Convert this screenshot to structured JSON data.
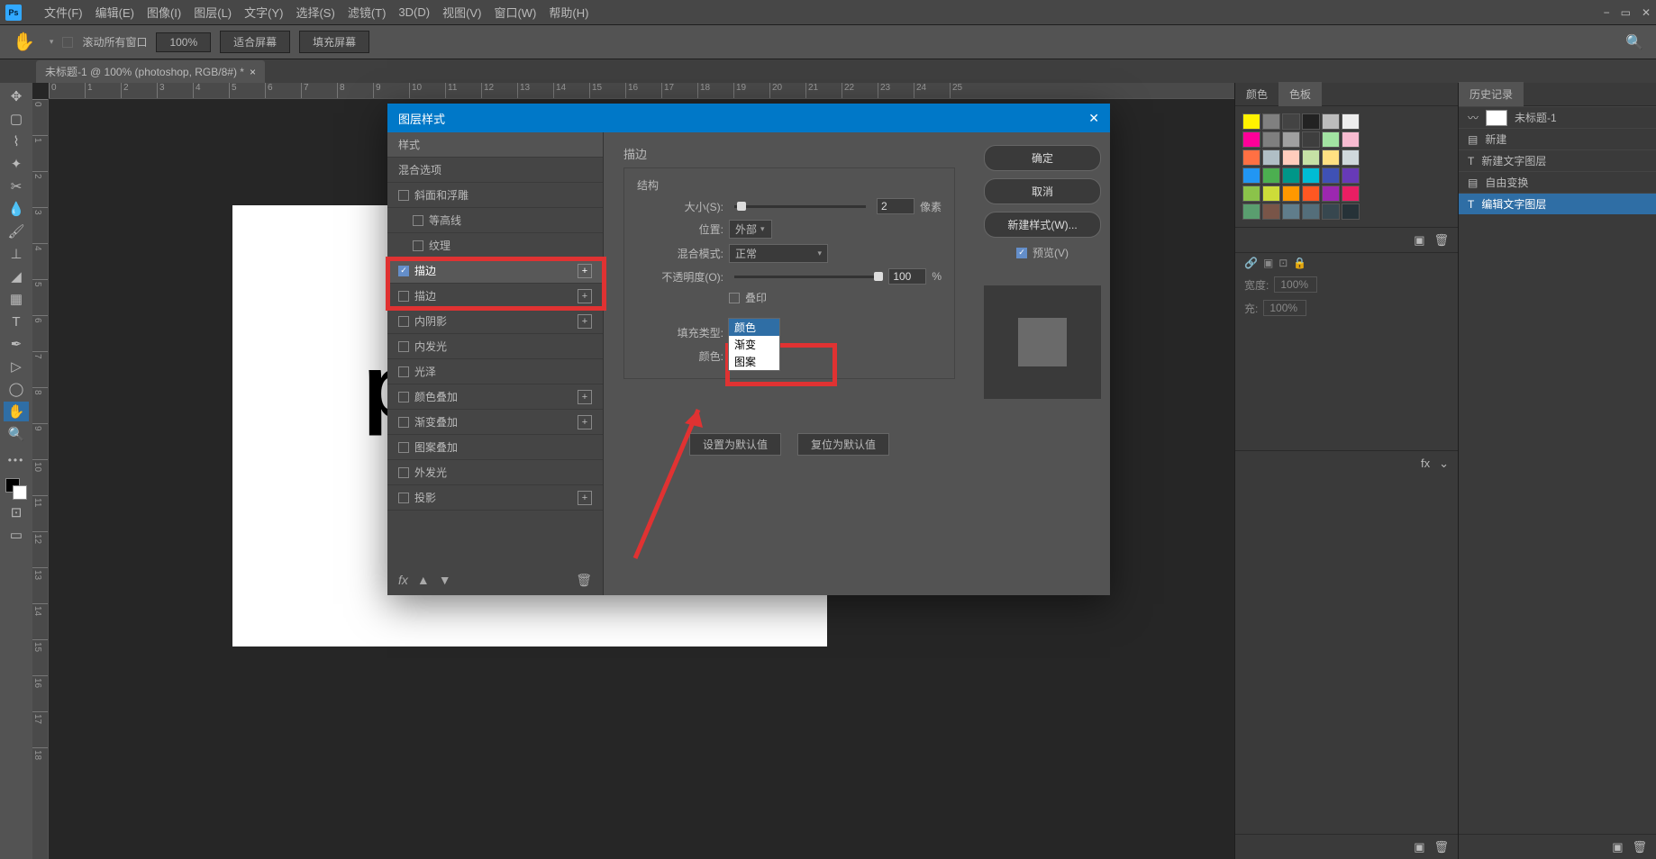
{
  "menubar": {
    "items": [
      "文件(F)",
      "编辑(E)",
      "图像(I)",
      "图层(L)",
      "文字(Y)",
      "选择(S)",
      "滤镜(T)",
      "3D(D)",
      "视图(V)",
      "窗口(W)",
      "帮助(H)"
    ]
  },
  "options": {
    "scroll_all": "滚动所有窗口",
    "zoom_label": "100%",
    "fit_screen": "适合屏幕",
    "fill_screen": "填充屏幕"
  },
  "doc_tab": {
    "title": "未标题-1 @ 100% (photoshop, RGB/8#) *"
  },
  "color_panel": {
    "tab1": "颜色",
    "tab2": "色板"
  },
  "history_panel": {
    "tab": "历史记录",
    "doc": "未标题-1",
    "items": [
      "新建",
      "新建文字图层",
      "自由变换",
      "编辑文字图层"
    ]
  },
  "props": {
    "width_label": "宽度:",
    "width": "100%",
    "fill_label": "充:",
    "fill": "100%"
  },
  "canvas_text": "pl",
  "dialog": {
    "title": "图层样式",
    "styles_header": "样式",
    "blend_header": "混合选项",
    "items": [
      {
        "label": "斜面和浮雕",
        "checked": false
      },
      {
        "label": "等高线",
        "checked": false,
        "indent": true
      },
      {
        "label": "纹理",
        "checked": false,
        "indent": true
      },
      {
        "label": "描边",
        "checked": true,
        "plus": true,
        "selected": true
      },
      {
        "label": "描边",
        "checked": false,
        "plus": true
      },
      {
        "label": "内阴影",
        "checked": false,
        "plus": true
      },
      {
        "label": "内发光",
        "checked": false
      },
      {
        "label": "光泽",
        "checked": false
      },
      {
        "label": "颜色叠加",
        "checked": false,
        "plus": true
      },
      {
        "label": "渐变叠加",
        "checked": false,
        "plus": true
      },
      {
        "label": "图案叠加",
        "checked": false
      },
      {
        "label": "外发光",
        "checked": false
      },
      {
        "label": "投影",
        "checked": false,
        "plus": true
      }
    ],
    "stroke_title": "描边",
    "structure_title": "结构",
    "size_label": "大小(S):",
    "size_value": "2",
    "size_unit": "像素",
    "position_label": "位置:",
    "position_value": "外部",
    "blendmode_label": "混合模式:",
    "blendmode_value": "正常",
    "opacity_label": "不透明度(O):",
    "opacity_value": "100",
    "opacity_unit": "%",
    "overprint_label": "叠印",
    "filltype_label": "填充类型:",
    "filltype_value": "颜色",
    "color_label": "颜色:",
    "dropdown": {
      "opt1": "颜色",
      "opt2": "渐变",
      "opt3": "图案"
    },
    "reset_default": "设置为默认值",
    "restore_default": "复位为默认值",
    "ok": "确定",
    "cancel": "取消",
    "newstyle": "新建样式(W)...",
    "preview_label": "预览(V)"
  },
  "swatches": [
    "#fff200",
    "#808080",
    "#434343",
    "#222222",
    "#bdbdbd",
    "#ededed",
    "#ff0099",
    "#7f7f7f",
    "#a0a0a0",
    "#3e3e3e",
    "#a2e3a2",
    "#f8bbd0",
    "#ff7043",
    "#b0bec5",
    "#ffccbc",
    "#c5e1a5",
    "#ffe082",
    "#cfd8dc",
    "#2196f3",
    "#4caf50",
    "#009688",
    "#00bcd4",
    "#3f51b5",
    "#673ab7",
    "#8bc34a",
    "#cddc39",
    "#ff9800",
    "#ff5722",
    "#9c27b0",
    "#e91e63",
    "#5a9e6f",
    "#795548",
    "#607d8b",
    "#546e7a",
    "#37474f",
    "#263238"
  ]
}
